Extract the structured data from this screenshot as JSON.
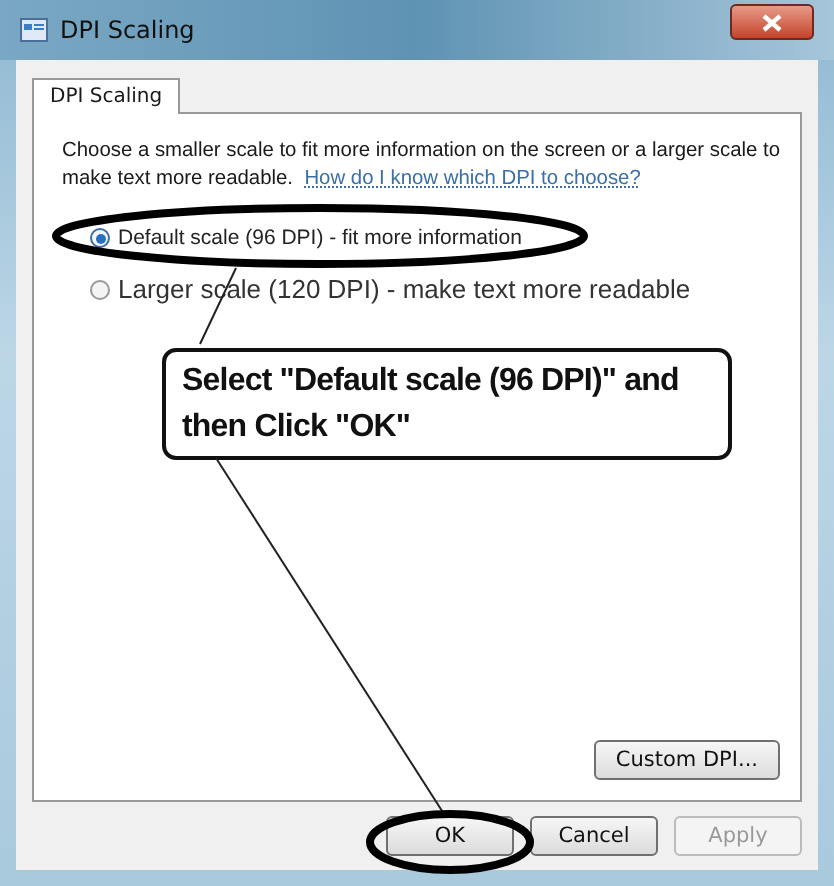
{
  "window": {
    "title": "DPI Scaling"
  },
  "tabs": [
    {
      "label": "DPI Scaling",
      "selected": true
    }
  ],
  "description": {
    "text": "Choose a smaller scale to fit more information on the screen or a larger scale to make text more readable.",
    "link": "How do I know which DPI to choose?"
  },
  "options": [
    {
      "label": "Default scale (96 DPI) - fit more information",
      "selected": true
    },
    {
      "label": "Larger scale (120 DPI) - make text more readable",
      "selected": false
    }
  ],
  "callout": "Select \"Default scale (96 DPI)\" and then Click \"OK\"",
  "custom_button": "Custom DPI...",
  "buttons": [
    {
      "label": "OK",
      "disabled": false
    },
    {
      "label": "Cancel",
      "disabled": false
    },
    {
      "label": "Apply",
      "disabled": true
    }
  ]
}
